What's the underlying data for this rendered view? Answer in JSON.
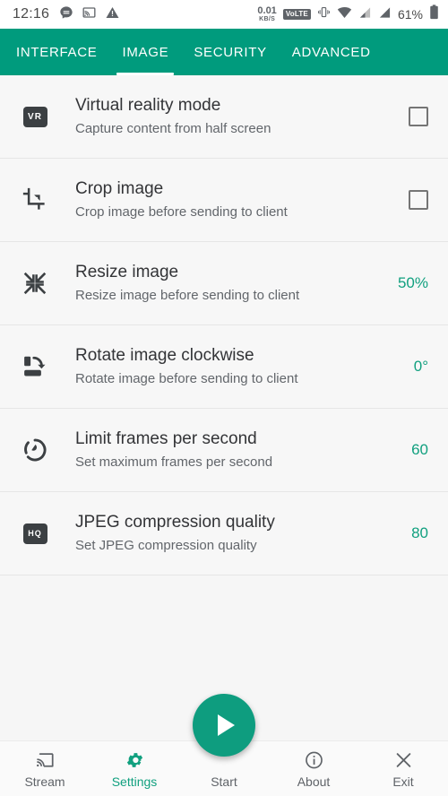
{
  "status_bar": {
    "clock": "12:16",
    "left_icons": [
      "message-icon",
      "cast-active-icon",
      "warning-icon"
    ],
    "data_rate_value": "0.01",
    "data_rate_unit": "KB/S",
    "volte_label": "VoLTE",
    "right_icons": [
      "vibrate-icon",
      "wifi-icon",
      "signal-one-icon",
      "signal-two-icon"
    ],
    "battery_percent": "61%"
  },
  "tabs": {
    "active_index": 1,
    "items": [
      {
        "label": "INTERFACE"
      },
      {
        "label": "IMAGE"
      },
      {
        "label": "SECURITY"
      },
      {
        "label": "ADVANCED"
      }
    ]
  },
  "settings": {
    "rows": [
      {
        "icon": "vr-badge-icon",
        "title": "Virtual reality mode",
        "subtitle": "Capture content from half screen",
        "control": "checkbox",
        "checked": false,
        "value": ""
      },
      {
        "icon": "crop-icon",
        "title": "Crop image",
        "subtitle": "Crop image before sending to client",
        "control": "checkbox",
        "checked": false,
        "value": ""
      },
      {
        "icon": "resize-icon",
        "title": "Resize image",
        "subtitle": "Resize image before sending to client",
        "control": "value",
        "value": "50%"
      },
      {
        "icon": "rotate-clockwise-icon",
        "title": "Rotate image clockwise",
        "subtitle": "Rotate image before sending to client",
        "control": "value",
        "value": "0°"
      },
      {
        "icon": "speedometer-icon",
        "title": "Limit frames per second",
        "subtitle": "Set maximum frames per second",
        "control": "value",
        "value": "60"
      },
      {
        "icon": "hq-badge-icon",
        "title": "JPEG compression quality",
        "subtitle": "Set JPEG compression quality",
        "control": "value",
        "value": "80"
      }
    ]
  },
  "fab": {
    "icon": "play-icon",
    "label": "Start"
  },
  "bottom_nav": {
    "active_index": 1,
    "items": [
      {
        "label": "Stream",
        "icon": "cast-icon"
      },
      {
        "label": "Settings",
        "icon": "gear-icon"
      },
      {
        "label": "Start",
        "icon": "play-icon"
      },
      {
        "label": "About",
        "icon": "info-icon"
      },
      {
        "label": "Exit",
        "icon": "close-icon"
      }
    ]
  },
  "colors": {
    "accent_teal": "#009b7d",
    "value_teal": "#11a07f",
    "content_bg": "#f6f6f6",
    "icon_dark": "#3c4043"
  }
}
